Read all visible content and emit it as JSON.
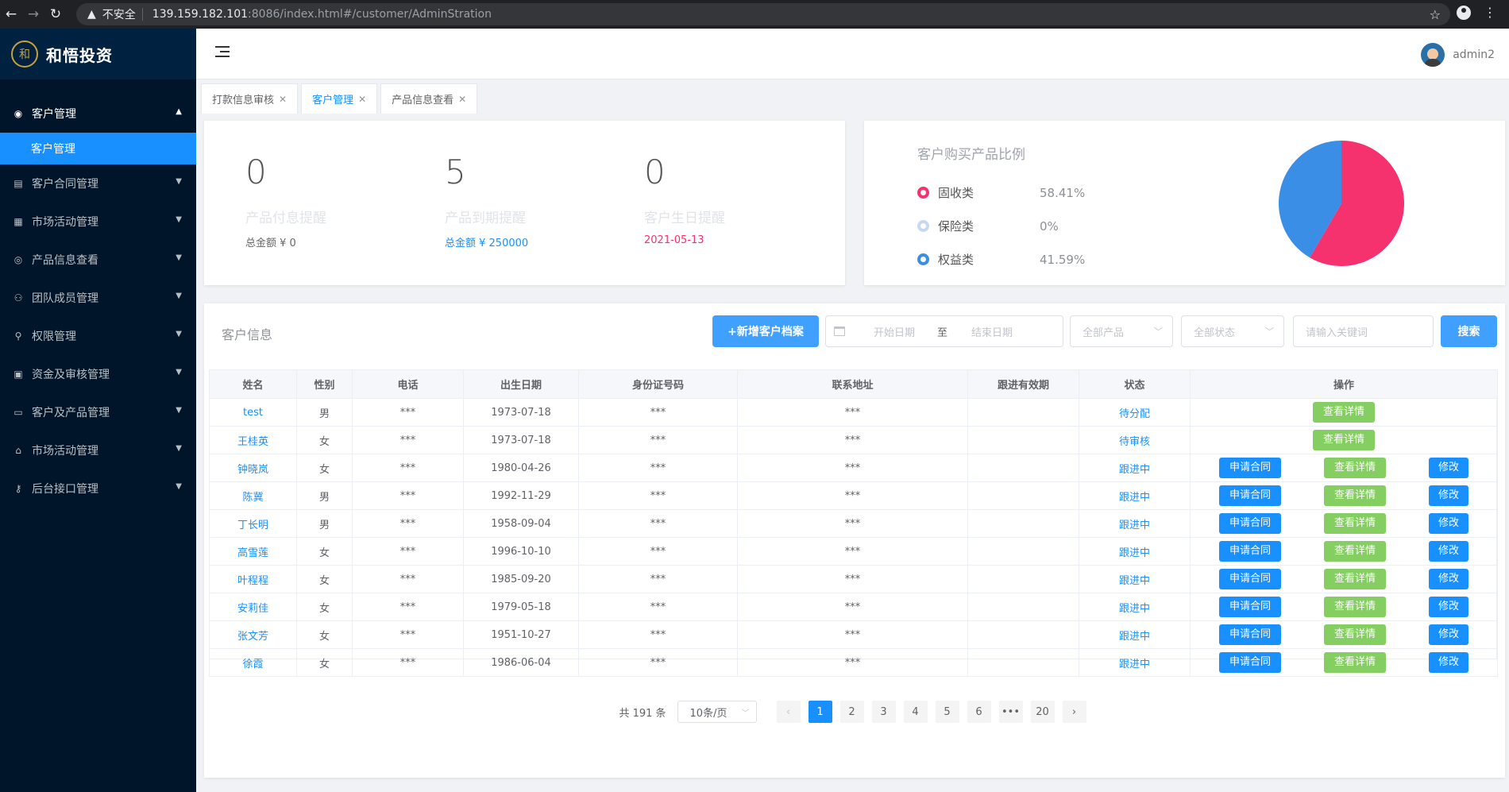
{
  "browser": {
    "security_label": "不安全",
    "url_host": "139.159.182.101",
    "url_path": ":8086/index.html#/customer/AdminStration"
  },
  "brand": {
    "logo_glyph": "和",
    "name": "和悟投资",
    "logo_color": "#c9a13b"
  },
  "sidebar": {
    "items": [
      {
        "label": "客户管理",
        "icon": "github-icon",
        "open": true
      },
      {
        "label": "客户合同管理",
        "icon": "file-icon"
      },
      {
        "label": "市场活动管理",
        "icon": "calendar-icon"
      },
      {
        "label": "产品信息查看",
        "icon": "coin-icon"
      },
      {
        "label": "团队成员管理",
        "icon": "team-icon"
      },
      {
        "label": "权限管理",
        "icon": "user-icon"
      },
      {
        "label": "资金及审核管理",
        "icon": "audit-icon"
      },
      {
        "label": "客户及产品管理",
        "icon": "desktop-icon"
      },
      {
        "label": "市场活动管理",
        "icon": "bank-icon"
      },
      {
        "label": "后台接口管理",
        "icon": "key-icon"
      }
    ],
    "sub_active": "客户管理"
  },
  "header": {
    "username": "admin2"
  },
  "tabs": [
    {
      "label": "打款信息审核",
      "active": false
    },
    {
      "label": "客户管理",
      "active": true
    },
    {
      "label": "产品信息查看",
      "active": false
    }
  ],
  "stats": [
    {
      "value": "0",
      "title": "产品付息提醒",
      "sub": "总金额 ¥ 0"
    },
    {
      "value": "5",
      "title": "产品到期提醒",
      "sub": "总金额 ¥ 250000"
    },
    {
      "value": "0",
      "title": "客户生日提醒",
      "sub": "2021-05-13"
    }
  ],
  "ratio": {
    "title": "客户购买产品比例",
    "items": [
      {
        "name": "固收类",
        "pct": "58.41%",
        "color": "#f5316e"
      },
      {
        "name": "保险类",
        "pct": "0%",
        "color": "#c6d9ee"
      },
      {
        "name": "权益类",
        "pct": "41.59%",
        "color": "#3a8ee6"
      }
    ]
  },
  "chart_data": {
    "type": "pie",
    "labels": [
      "固收类",
      "保险类",
      "权益类"
    ],
    "values": [
      58.41,
      0,
      41.59
    ],
    "colors": [
      "#f5316e",
      "#c6d9ee",
      "#3a8ee6"
    ]
  },
  "customers": {
    "title": "客户信息",
    "add_button": "+新增客户档案",
    "date_start_placeholder": "开始日期",
    "date_sep": "至",
    "date_end_placeholder": "结束日期",
    "product_select": "全部产品",
    "status_select": "全部状态",
    "keyword_placeholder": "请输入关键词",
    "search_button": "搜索",
    "columns": [
      "姓名",
      "性别",
      "电话",
      "出生日期",
      "身份证号码",
      "联系地址",
      "跟进有效期",
      "状态",
      "操作"
    ],
    "rows": [
      {
        "name": "test",
        "gender": "男",
        "phone": "***",
        "birth": "1973-07-18",
        "id": "***",
        "address": "***",
        "follow": "",
        "status": "待分配",
        "actions": "detail"
      },
      {
        "name": "王桂英",
        "gender": "女",
        "phone": "***",
        "birth": "1973-07-18",
        "id": "***",
        "address": "***",
        "follow": "",
        "status": "待审核",
        "actions": "detail"
      },
      {
        "name": "钟晓岚",
        "gender": "女",
        "phone": "***",
        "birth": "1980-04-26",
        "id": "***",
        "address": "***",
        "follow": "",
        "status": "跟进中",
        "actions": "full"
      },
      {
        "name": "陈冀",
        "gender": "男",
        "phone": "***",
        "birth": "1992-11-29",
        "id": "***",
        "address": "***",
        "follow": "",
        "status": "跟进中",
        "actions": "full"
      },
      {
        "name": "丁长明",
        "gender": "男",
        "phone": "***",
        "birth": "1958-09-04",
        "id": "***",
        "address": "***",
        "follow": "",
        "status": "跟进中",
        "actions": "full"
      },
      {
        "name": "高雪莲",
        "gender": "女",
        "phone": "***",
        "birth": "1996-10-10",
        "id": "***",
        "address": "***",
        "follow": "",
        "status": "跟进中",
        "actions": "full"
      },
      {
        "name": "叶程程",
        "gender": "女",
        "phone": "***",
        "birth": "1985-09-20",
        "id": "***",
        "address": "***",
        "follow": "",
        "status": "跟进中",
        "actions": "full"
      },
      {
        "name": "安莉佳",
        "gender": "女",
        "phone": "***",
        "birth": "1979-05-18",
        "id": "***",
        "address": "***",
        "follow": "",
        "status": "跟进中",
        "actions": "full"
      },
      {
        "name": "张文芳",
        "gender": "女",
        "phone": "***",
        "birth": "1951-10-27",
        "id": "***",
        "address": "***",
        "follow": "",
        "status": "跟进中",
        "actions": "full"
      },
      {
        "name": "徐霞",
        "gender": "女",
        "phone": "***",
        "birth": "1986-06-04",
        "id": "***",
        "address": "***",
        "follow": "",
        "status": "跟进中",
        "actions": "full"
      }
    ],
    "action_labels": {
      "apply": "申请合同",
      "detail": "查看详情",
      "edit": "修改"
    }
  },
  "pagination": {
    "total": "共 191 条",
    "page_size": "10条/页",
    "pages": [
      "1",
      "2",
      "3",
      "4",
      "5",
      "6",
      "•••",
      "20"
    ],
    "current": "1"
  }
}
